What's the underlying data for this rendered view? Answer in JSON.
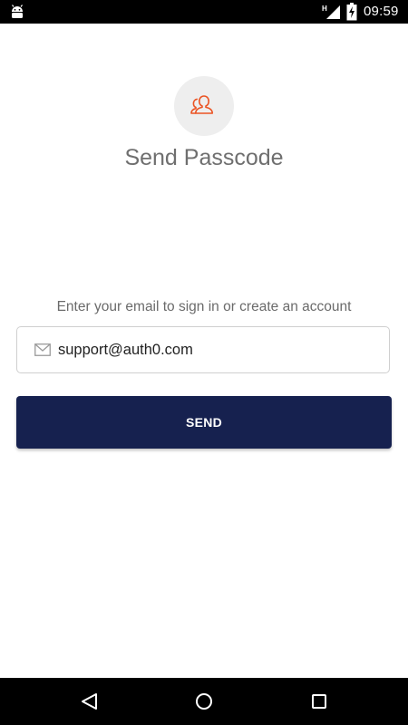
{
  "status_bar": {
    "time": "09:59",
    "network_label": "H",
    "icons": [
      "android-icon",
      "network-signal-icon",
      "battery-charging-icon"
    ]
  },
  "header": {
    "avatar_icon": "users-icon",
    "title": "Send Passcode"
  },
  "form": {
    "instructions": "Enter your email to sign in or create an account",
    "email_icon": "mail-icon",
    "email_value": "support@auth0.com",
    "send_label": "SEND"
  },
  "nav_bar": {
    "icons": [
      "back-icon",
      "home-icon",
      "recents-icon"
    ]
  },
  "colors": {
    "accent": "#eb5424",
    "button_bg": "#16214f",
    "avatar_bg": "#eeeeee",
    "title_text": "#6f6f6f"
  }
}
